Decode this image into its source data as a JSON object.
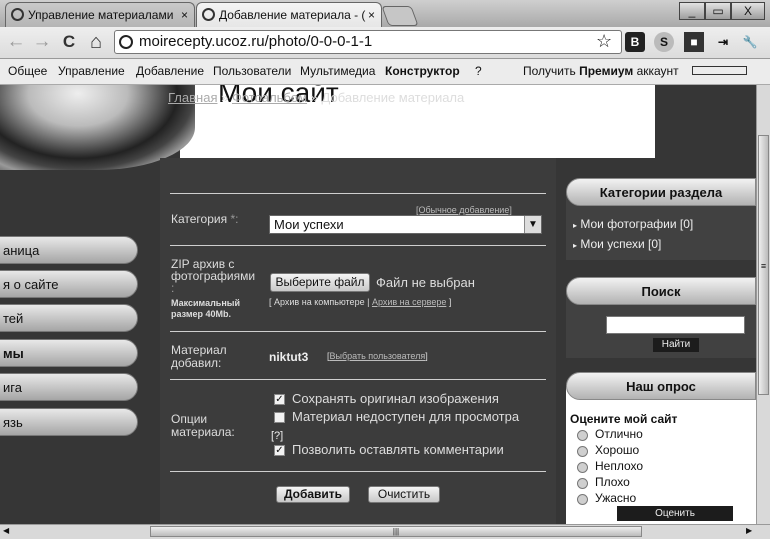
{
  "browser": {
    "tabs": [
      {
        "label": "Управление материалами",
        "close": "×"
      },
      {
        "label": "Добавление материала - (",
        "close": "×"
      }
    ],
    "window_controls": [
      "_",
      "▭",
      "X"
    ],
    "url": "moirecepty.ucoz.ru/photo/0-0-0-1-1",
    "nav": {
      "back": "←",
      "forward": "→",
      "reload": "C",
      "home": "⌂"
    },
    "extensions": [
      "B",
      "S",
      "■",
      "⇥",
      "🔧"
    ]
  },
  "adminbar": {
    "items": [
      "Общее",
      "Управление",
      "Добавление",
      "Пользователи",
      "Мультимедиа",
      "Конструктор",
      "?"
    ],
    "premium_pre": "Получить",
    "premium_bold": "Премиум",
    "premium_post": "аккаунт"
  },
  "site": {
    "title": "Мои сайт"
  },
  "leftnav": [
    "аница",
    "я о сайте",
    "тей",
    "мы",
    "ига",
    "язь"
  ],
  "breadcrumb": {
    "home": "Главная",
    "sep1": "»",
    "section": "Фотоальбом",
    "sep2": "»",
    "current": "Добавление материала"
  },
  "form": {
    "simple_add": "[Обычное добавление]",
    "category_label": "Категория",
    "category_req": "*:",
    "category_value": "Мои успехи",
    "zip_label_1": "ZIP архив с",
    "zip_label_2": "фотографиями",
    "zip_req": ":",
    "choose_file": "Выберите файл",
    "no_file": "Файл не выбран",
    "max_size_1": "Максимальный",
    "max_size_2": "размер 40Mb.",
    "archive_pc": "[ Архив на компьютере |",
    "archive_server": "Архив на сервере",
    "archive_close": "]",
    "author_label_1": "Материал",
    "author_label_2": "добавил:",
    "author_value": "niktut3",
    "choose_user": "Выбрать пользователя",
    "options_label_1": "Опции",
    "options_label_2": "материала:",
    "options": [
      {
        "label": "Сохранять оригинал изображения",
        "checked": true
      },
      {
        "label": "Материал недоступен для просмотра",
        "checked": false
      },
      {
        "label": "Позволить оставлять комментарии",
        "checked": true
      }
    ],
    "help": "[?]",
    "submit": "Добавить",
    "reset": "Очистить"
  },
  "sidebar": {
    "categories_title": "Категории раздела",
    "categories": [
      "Мои фотографии [0]",
      "Мои успехи [0]"
    ],
    "search_title": "Поиск",
    "search_button": "Найти",
    "poll_title": "Наш опрос",
    "poll_question": "Оцените мой сайт",
    "poll_options": [
      "Отлично",
      "Хорошо",
      "Неплохо",
      "Плохо",
      "Ужасно"
    ],
    "vote_button": "Оценить"
  },
  "scroll": {
    "left": "◀",
    "right": "▶",
    "grip": "|||",
    "up_grip": "≡"
  }
}
